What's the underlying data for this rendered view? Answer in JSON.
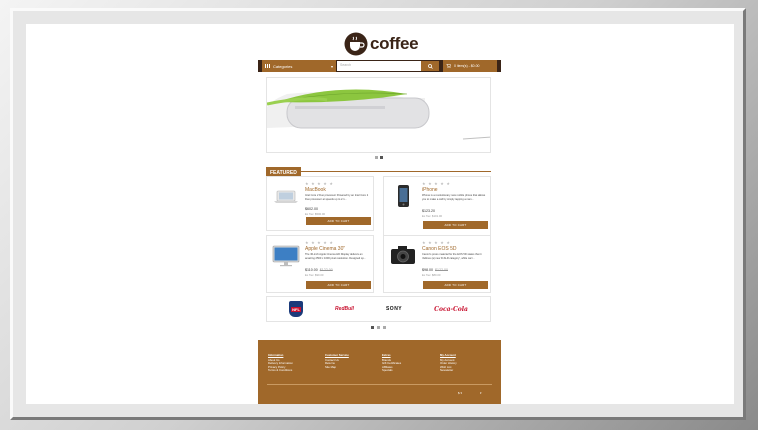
{
  "brand": {
    "logo_text": "coffee"
  },
  "nav": {
    "categories_label": "Categories",
    "search_placeholder": "Search",
    "cart_label": "0 item(s) - $0.00"
  },
  "slider": {
    "dots": 2,
    "active": 1
  },
  "featured": {
    "heading": "FEATURED",
    "products": [
      {
        "name": "MacBook",
        "desc": "Intel Core 2 Duo processor Powered by an Intel Core 2 Duo processor at speeds up to 2.1...",
        "price": "$602.00",
        "price_old": "",
        "tax": "Ex Tax: $500.00",
        "button": "ADD TO CART",
        "thumb_icon": "laptop-icon"
      },
      {
        "name": "iPhone",
        "desc": "iPhone is a revolutionary new mobile phone that allows you to make a call by simply tapping a nam...",
        "price": "$123.20",
        "price_old": "",
        "tax": "Ex Tax: $101.00",
        "button": "ADD TO CART",
        "thumb_icon": "phone-icon"
      },
      {
        "name": "Apple Cinema 30\"",
        "desc": "The 30-inch Apple Cinema HD Display delivers an amazing 2560 x 1600 pixel resolution. Designed sp...",
        "price": "$110.00",
        "price_old": "$122.00",
        "tax": "Ex Tax: $90.00",
        "button": "ADD TO CART",
        "thumb_icon": "monitor-icon"
      },
      {
        "name": "Canon EOS 5D",
        "desc": "Canon's press material for the EOS 5D states that it 'defines (a) new D-SLR category', while we'r...",
        "price": "$98.00",
        "price_old": "$122.00",
        "tax": "Ex Tax: $80.00",
        "button": "ADD TO CART",
        "thumb_icon": "camera-icon"
      }
    ]
  },
  "brands": [
    "NFL",
    "RedBull",
    "SONY",
    "Coca-Cola"
  ],
  "footer": {
    "columns": [
      {
        "heading": "Information",
        "links": [
          "About Us",
          "Delivery Information",
          "Privacy Policy",
          "Terms & Conditions"
        ]
      },
      {
        "heading": "Customer Service",
        "links": [
          "Contact Us",
          "Returns",
          "Site Map"
        ]
      },
      {
        "heading": "Extras",
        "links": [
          "Brands",
          "Gift Certificates",
          "Affiliates",
          "Specials"
        ]
      },
      {
        "heading": "My Account",
        "links": [
          "My Account",
          "Order History",
          "Wish List",
          "Newsletter"
        ]
      }
    ],
    "currency": "$ ▾",
    "language": "▾"
  },
  "colors": {
    "accent": "#a0682a",
    "dark": "#3a2417"
  }
}
